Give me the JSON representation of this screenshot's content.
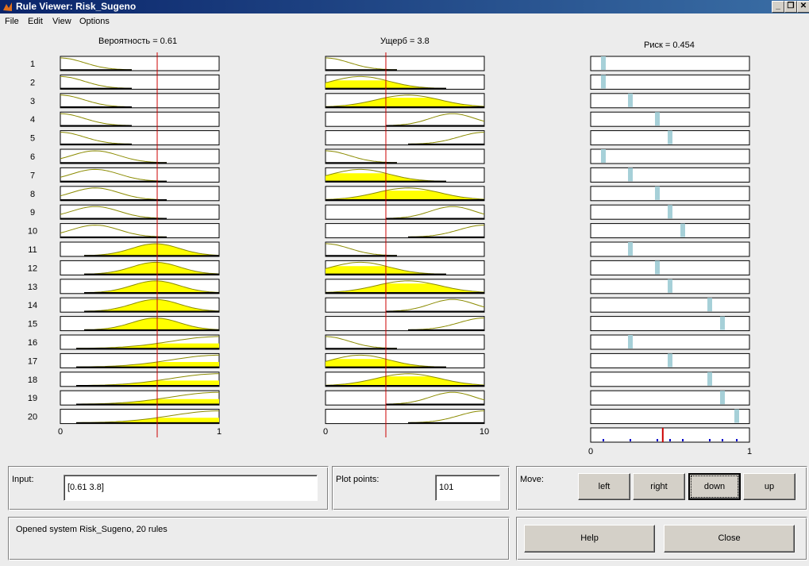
{
  "window": {
    "title": "Rule Viewer: Risk_Sugeno",
    "controls": [
      "_",
      "❐",
      "✕"
    ]
  },
  "menu": [
    "File",
    "Edit",
    "View",
    "Options"
  ],
  "columns": {
    "input1_title": "Вероятность = 0.61",
    "input2_title": "Ущерб = 3.8",
    "output_title": "Риск = 0.454"
  },
  "axes": {
    "input1": {
      "min": "0",
      "max": "1"
    },
    "input2": {
      "min": "0",
      "max": "10"
    },
    "output": {
      "min": "0",
      "max": "1"
    }
  },
  "chart_data": {
    "type": "rule-viewer",
    "input_values": {
      "Вероятность": 0.61,
      "Ущерб": 3.8
    },
    "output_value": 0.454,
    "ranges": {
      "Вероятность": [
        0,
        1
      ],
      "Ущерб": [
        0,
        10
      ],
      "Риск": [
        0,
        1
      ]
    },
    "rules": [
      {
        "n": 1,
        "in1": [
          0,
          0.15
        ],
        "in2": [
          0,
          1.5
        ],
        "out": 0.08
      },
      {
        "n": 2,
        "in1": [
          0,
          0.15
        ],
        "in2": [
          2.2,
          1.8
        ],
        "out": 0.08
      },
      {
        "n": 3,
        "in1": [
          0,
          0.15
        ],
        "in2": [
          5.2,
          2.0
        ],
        "out": 0.25
      },
      {
        "n": 4,
        "in1": [
          0,
          0.15
        ],
        "in2": [
          8.0,
          1.4
        ],
        "out": 0.42
      },
      {
        "n": 5,
        "in1": [
          0,
          0.15
        ],
        "in2": [
          10,
          1.6
        ],
        "out": 0.5
      },
      {
        "n": 6,
        "in1": [
          0.22,
          0.15
        ],
        "in2": [
          0,
          1.5
        ],
        "out": 0.08
      },
      {
        "n": 7,
        "in1": [
          0.22,
          0.15
        ],
        "in2": [
          2.2,
          1.8
        ],
        "out": 0.25
      },
      {
        "n": 8,
        "in1": [
          0.22,
          0.15
        ],
        "in2": [
          5.2,
          2.0
        ],
        "out": 0.42
      },
      {
        "n": 9,
        "in1": [
          0.22,
          0.15
        ],
        "in2": [
          8.0,
          1.4
        ],
        "out": 0.5
      },
      {
        "n": 10,
        "in1": [
          0.22,
          0.15
        ],
        "in2": [
          10,
          1.6
        ],
        "out": 0.58
      },
      {
        "n": 11,
        "in1": [
          0.6,
          0.15
        ],
        "in2": [
          0,
          1.5
        ],
        "out": 0.25
      },
      {
        "n": 12,
        "in1": [
          0.6,
          0.15
        ],
        "in2": [
          2.2,
          1.8
        ],
        "out": 0.42
      },
      {
        "n": 13,
        "in1": [
          0.6,
          0.15
        ],
        "in2": [
          5.2,
          2.0
        ],
        "out": 0.5
      },
      {
        "n": 14,
        "in1": [
          0.6,
          0.15
        ],
        "in2": [
          8.0,
          1.4
        ],
        "out": 0.75
      },
      {
        "n": 15,
        "in1": [
          0.6,
          0.15
        ],
        "in2": [
          10,
          1.6
        ],
        "out": 0.83
      },
      {
        "n": 16,
        "in1": [
          1,
          0.3
        ],
        "in2": [
          0,
          1.5
        ],
        "out": 0.25
      },
      {
        "n": 17,
        "in1": [
          1,
          0.3
        ],
        "in2": [
          2.2,
          1.8
        ],
        "out": 0.5
      },
      {
        "n": 18,
        "in1": [
          1,
          0.3
        ],
        "in2": [
          5.2,
          2.0
        ],
        "out": 0.75
      },
      {
        "n": 19,
        "in1": [
          1,
          0.3
        ],
        "in2": [
          8.0,
          1.4
        ],
        "out": 0.83
      },
      {
        "n": 20,
        "in1": [
          1,
          0.3
        ],
        "in2": [
          10,
          1.6
        ],
        "out": 0.92
      }
    ]
  },
  "colors": {
    "fill": "#ffff00",
    "curve": "#8b8b00",
    "marker": "#cc0000",
    "output_bar": "#a6d0d8",
    "output_fire": "#0000cc"
  },
  "input_panel": {
    "label": "Input:",
    "value": "[0.61 3.8]"
  },
  "plot_panel": {
    "label": "Plot points:",
    "value": "101"
  },
  "move_panel": {
    "label": "Move:",
    "left": "left",
    "right": "right",
    "down": "down",
    "up": "up"
  },
  "status": "Opened system Risk_Sugeno, 20 rules",
  "buttons": {
    "help": "Help",
    "close": "Close"
  }
}
